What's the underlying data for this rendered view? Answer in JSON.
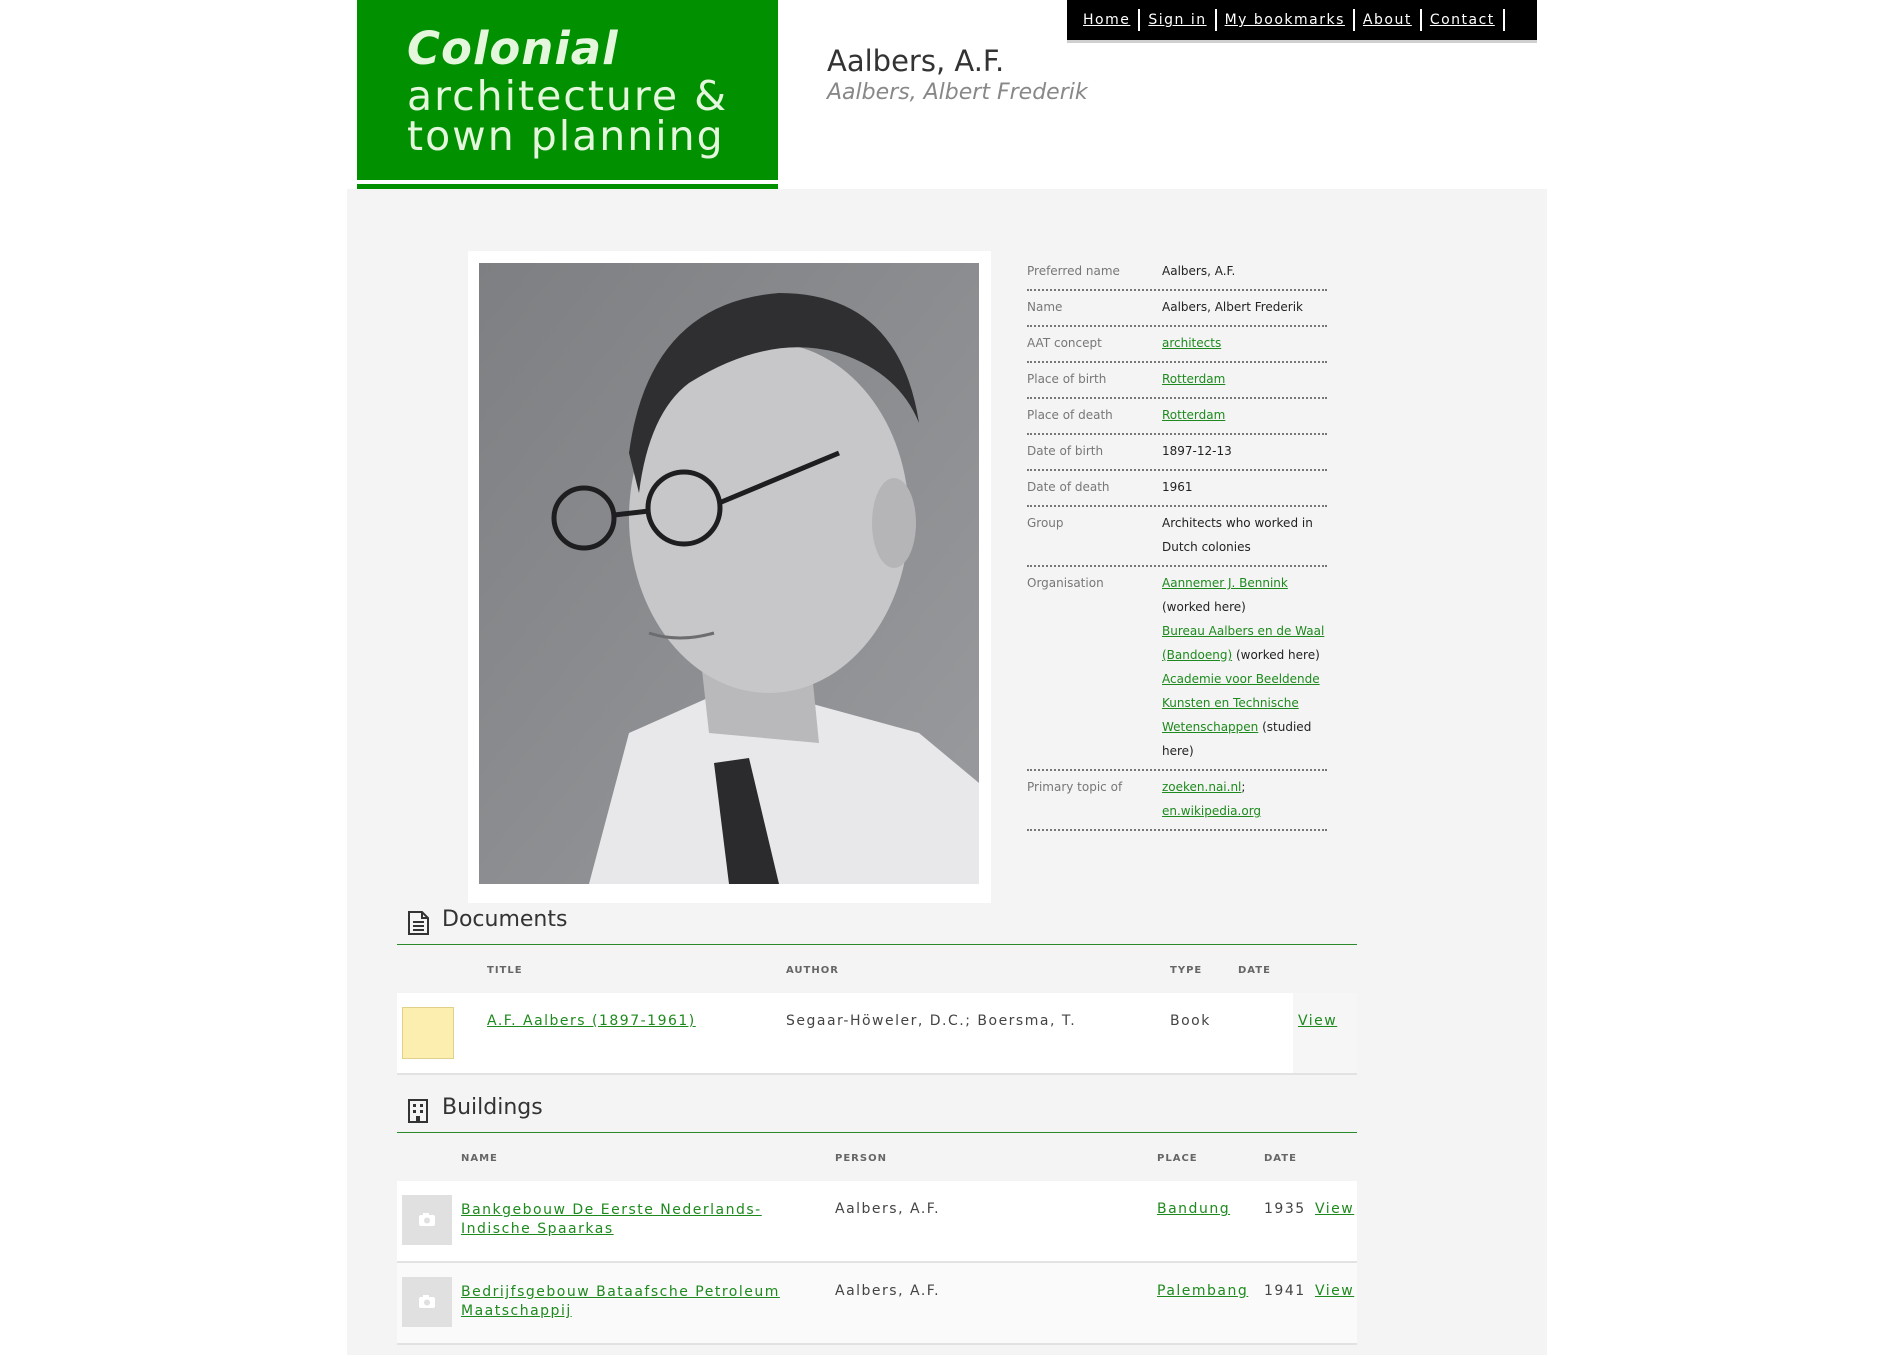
{
  "logo": {
    "line1": "Colonial",
    "line2": "architecture &",
    "line3": "town planning"
  },
  "nav": {
    "items": [
      "Home",
      "Sign in",
      "My bookmarks",
      "About",
      "Contact"
    ]
  },
  "header": {
    "title": "Aalbers, A.F.",
    "subtitle": "Aalbers, Albert Frederik"
  },
  "properties": {
    "preferred_name": {
      "label": "Preferred name",
      "value": "Aalbers, A.F."
    },
    "name": {
      "label": "Name",
      "value": "Aalbers, Albert Frederik"
    },
    "aat_concept": {
      "label": "AAT concept",
      "value": "architects"
    },
    "place_of_birth": {
      "label": "Place of birth",
      "value": "Rotterdam"
    },
    "place_of_death": {
      "label": "Place of death",
      "value": "Rotterdam"
    },
    "date_of_birth": {
      "label": "Date of birth",
      "value": "1897-12-13"
    },
    "date_of_death": {
      "label": "Date of death",
      "value": "1961"
    },
    "group": {
      "label": "Group",
      "value": "Architects who worked in Dutch colonies"
    },
    "organisation": {
      "label": "Organisation",
      "items": [
        {
          "name": "Aannemer J. Bennink",
          "note": "(worked here)"
        },
        {
          "name": "Bureau Aalbers en de Waal (Bandoeng)",
          "note": "(worked here)"
        },
        {
          "name": "Academie voor Beeldende Kunsten en Technische Wetenschappen",
          "note": "(studied here)"
        }
      ]
    },
    "primary_topic": {
      "label": "Primary topic of",
      "link1": "zoeken.nai.nl",
      "sep": ";",
      "link2": "en.wikipedia.org"
    }
  },
  "documents": {
    "title": "Documents",
    "columns": {
      "title": "TITLE",
      "author": "AUTHOR",
      "type": "TYPE",
      "date": "DATE"
    },
    "rows": [
      {
        "title": "A.F. Aalbers (1897-1961)",
        "author": "Segaar-Höweler, D.C.; Boersma, T.",
        "type": "Book",
        "date": "",
        "view": "View"
      }
    ]
  },
  "buildings": {
    "title": "Buildings",
    "columns": {
      "name": "NAME",
      "person": "PERSON",
      "place": "PLACE",
      "date": "DATE"
    },
    "rows": [
      {
        "name": "Bankgebouw De Eerste Nederlands-Indische Spaarkas",
        "person": "Aalbers, A.F.",
        "place": "Bandung",
        "date": "1935",
        "view": "View"
      },
      {
        "name": "Bedrijfsgebouw Bataafsche Petroleum Maatschappij",
        "person": "Aalbers, A.F.",
        "place": "Palembang",
        "date": "1941",
        "view": "View"
      }
    ]
  },
  "colors": {
    "brand_green": "#009000",
    "link_green": "#1e8a1e",
    "panel_gray": "#f4f4f4"
  }
}
